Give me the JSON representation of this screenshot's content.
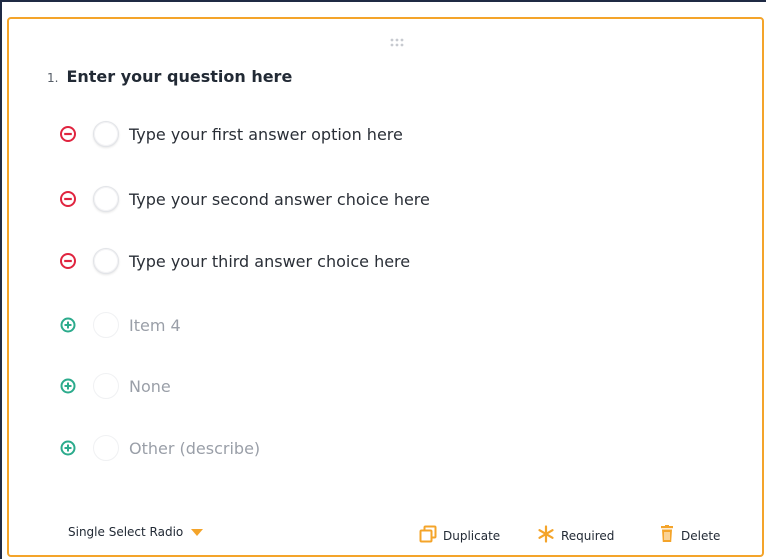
{
  "question": {
    "number": "1.",
    "text": "Enter your question here"
  },
  "options": [
    {
      "label": "Type your first answer option here",
      "icon": "remove-circle-icon",
      "state": "active"
    },
    {
      "label": "Type your second answer choice here",
      "icon": "remove-circle-icon",
      "state": "active"
    },
    {
      "label": "Type your third answer choice here",
      "icon": "remove-circle-icon",
      "state": "active"
    },
    {
      "label": "Item 4",
      "icon": "add-circle-icon",
      "state": "suggested"
    },
    {
      "label": "None",
      "icon": "add-circle-icon",
      "state": "suggested"
    },
    {
      "label": "Other (describe)",
      "icon": "add-circle-icon",
      "state": "suggested"
    }
  ],
  "footer": {
    "question_type": "Single Select Radio",
    "duplicate_label": "Duplicate",
    "required_label": "Required",
    "delete_label": "Delete"
  },
  "colors": {
    "accent": "#f4a42a",
    "remove": "#e0243f",
    "add": "#2bab8c",
    "frame": "#1f2a44"
  }
}
